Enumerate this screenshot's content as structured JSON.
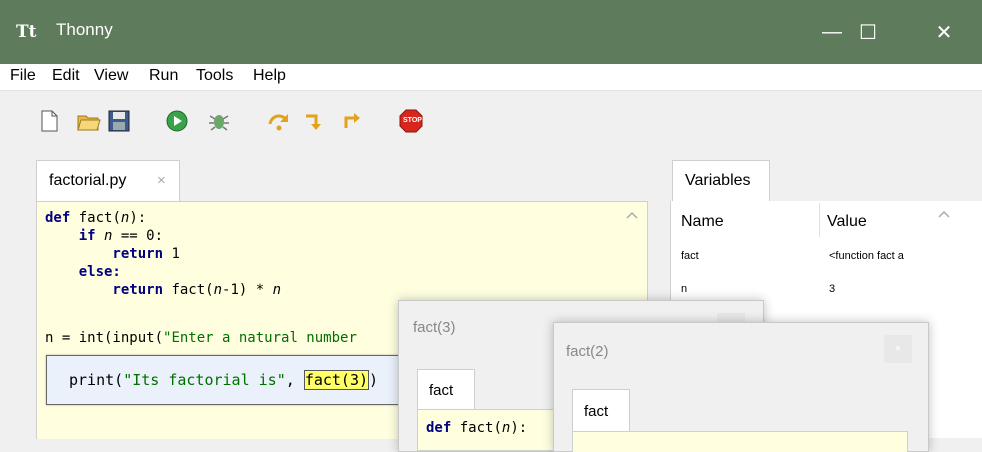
{
  "window": {
    "title": "Thonny",
    "minimize": "—",
    "maximize": "☐",
    "close": "✕"
  },
  "menu": [
    "File",
    "Edit",
    "View",
    "Run",
    "Tools",
    "Help"
  ],
  "toolbar": {
    "stop_label": "STOP"
  },
  "editor": {
    "tab_label": "factorial.py",
    "tab_close": "×",
    "lines": {
      "l1a": "def",
      "l1b": " fact(",
      "l1c": "n",
      "l1d": "):",
      "l2a": "    if ",
      "l2b": "n",
      "l2c": " == 0:",
      "l3a": "        return",
      "l3b": " 1",
      "l4a": "    else:",
      "l5a": "        return",
      "l5b": " fact(",
      "l5c": "n",
      "l5d": "-1) * ",
      "l5e": "n",
      "l7a": "n = int(input(",
      "l7b": "\"Enter a natural number"
    },
    "eval_popup": {
      "prefix": "print(",
      "string": "\"Its factorial is\"",
      "comma": ", ",
      "call": "fact(3)",
      "suffix": ")"
    }
  },
  "variables": {
    "tab_label": "Variables",
    "headers": {
      "name": "Name",
      "value": "Value"
    },
    "rows": [
      {
        "name": "fact",
        "value": "<function fact a"
      },
      {
        "name": "n",
        "value": "3"
      }
    ]
  },
  "frames": [
    {
      "title": "fact(3)",
      "tab_label": "fact",
      "code_kw": "def",
      "code_rest": " fact(",
      "code_param": "n",
      "code_end": "):"
    },
    {
      "title": "fact(2)",
      "tab_label": "fact",
      "close": "×"
    }
  ]
}
